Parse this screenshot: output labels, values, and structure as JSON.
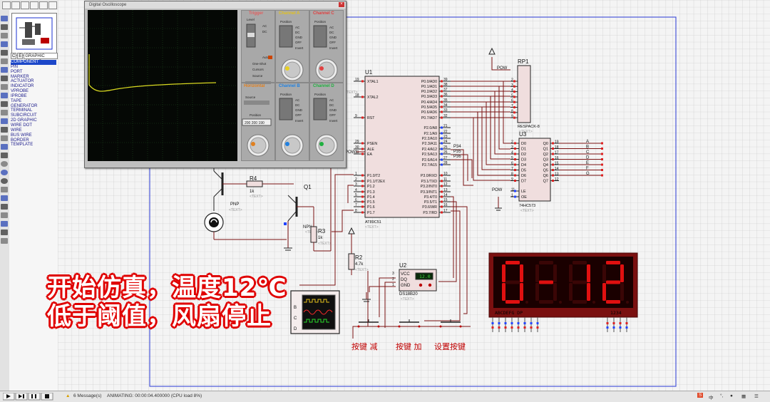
{
  "oscilloscope": {
    "title": "Digital Oscilloscope",
    "channel_a": "Channel A",
    "channel_b": "Channel B",
    "channel_c": "Channel C",
    "channel_d": "Channel D",
    "trigger": "Trigger",
    "horizontal": "Horizontal",
    "labels": {
      "level": "Level",
      "position": "Position",
      "auto": "Auto",
      "one_shot": "One-Shot",
      "cursors": "Cursors",
      "source": "Source",
      "ac": "AC",
      "dc": "DC",
      "gnd": "GND",
      "off": "OFF",
      "invert": "Invert"
    },
    "readout": "200 200 190",
    "trace_color": "#d8d820"
  },
  "mode_tabs": [
    "C",
    "E",
    "GRAPHIC STYLES"
  ],
  "mode_list": [
    "COMPONENT",
    "PIN",
    "PORT",
    "MARKER",
    "ACTUATOR",
    "INDICATOR",
    "VPROBE",
    "IPROBE",
    "TAPE",
    "GENERATOR",
    "TERMINAL",
    "SUBCIRCUIT",
    "2D GRAPHIC",
    "WIRE DOT",
    "WIRE",
    "BUS WIRE",
    "BORDER",
    "TEMPLATE"
  ],
  "mode_selected": "COMPONENT",
  "circuit": {
    "u1": {
      "ref": "U1",
      "part": "AT89C51",
      "text": "<TEXT>",
      "left_pins": [
        {
          "num": "19",
          "name": "XTAL1"
        },
        {
          "num": "18",
          "name": "XTAL2"
        },
        {
          "num": "9",
          "name": "RST"
        },
        {
          "num": "29",
          "name": "PSEN"
        },
        {
          "num": "30",
          "name": "ALE"
        },
        {
          "num": "31",
          "name": "EA"
        },
        {
          "num": "1",
          "name": "P1.0/T2"
        },
        {
          "num": "2",
          "name": "P1.1/T2EX"
        },
        {
          "num": "3",
          "name": "P1.2"
        },
        {
          "num": "4",
          "name": "P1.3"
        },
        {
          "num": "5",
          "name": "P1.4"
        },
        {
          "num": "6",
          "name": "P1.5"
        },
        {
          "num": "7",
          "name": "P1.6"
        },
        {
          "num": "8",
          "name": "P1.7"
        }
      ],
      "right_pins": [
        {
          "num": "39",
          "name": "P0.0/AD0"
        },
        {
          "num": "38",
          "name": "P0.1/AD1"
        },
        {
          "num": "37",
          "name": "P0.2/AD2"
        },
        {
          "num": "36",
          "name": "P0.3/AD3"
        },
        {
          "num": "35",
          "name": "P0.4/AD4"
        },
        {
          "num": "34",
          "name": "P0.5/AD5"
        },
        {
          "num": "33",
          "name": "P0.6/AD6"
        },
        {
          "num": "32",
          "name": "P0.7/AD7"
        },
        {
          "num": "21",
          "name": "P2.0/A8"
        },
        {
          "num": "22",
          "name": "P2.1/A9"
        },
        {
          "num": "23",
          "name": "P2.2/A10"
        },
        {
          "num": "24",
          "name": "P2.3/A11"
        },
        {
          "num": "25",
          "name": "P2.4/A12"
        },
        {
          "num": "26",
          "name": "P2.5/A13"
        },
        {
          "num": "27",
          "name": "P2.6/A14"
        },
        {
          "num": "28",
          "name": "P2.7/A15"
        },
        {
          "num": "10",
          "name": "P3.0/RXD"
        },
        {
          "num": "11",
          "name": "P3.1/TXD"
        },
        {
          "num": "12",
          "name": "P3.2/INT0"
        },
        {
          "num": "13",
          "name": "P3.3/INT1"
        },
        {
          "num": "14",
          "name": "P3.4/T0"
        },
        {
          "num": "15",
          "name": "P3.5/T1"
        },
        {
          "num": "16",
          "name": "P3.6/WR"
        },
        {
          "num": "17",
          "name": "P3.7/RD"
        }
      ]
    },
    "rp1": {
      "ref": "RP1",
      "part": "RESPACK-8",
      "text": "<TEXT>",
      "pow": "POW",
      "pins": [
        "2",
        "3",
        "4",
        "5",
        "6",
        "7",
        "8",
        "9"
      ]
    },
    "u3": {
      "ref": "U3",
      "part": "74HC573",
      "text": "<TEXT>",
      "d_pins": [
        {
          "num": "2",
          "name": "D0"
        },
        {
          "num": "3",
          "name": "D1"
        },
        {
          "num": "4",
          "name": "D2"
        },
        {
          "num": "5",
          "name": "D3"
        },
        {
          "num": "6",
          "name": "D4"
        },
        {
          "num": "7",
          "name": "D5"
        },
        {
          "num": "8",
          "name": "D6"
        },
        {
          "num": "9",
          "name": "D7"
        }
      ],
      "q_pins": [
        {
          "num": "19",
          "name": "Q0"
        },
        {
          "num": "18",
          "name": "Q1"
        },
        {
          "num": "17",
          "name": "Q2"
        },
        {
          "num": "16",
          "name": "Q3"
        },
        {
          "num": "15",
          "name": "Q4"
        },
        {
          "num": "14",
          "name": "Q5"
        },
        {
          "num": "13",
          "name": "Q6"
        },
        {
          "num": "12",
          "name": "Q7"
        }
      ],
      "le": {
        "num": "11",
        "name": "LE"
      },
      "oe": {
        "num": "1",
        "name": "OE"
      },
      "pow": "POW",
      "outputs": [
        "A",
        "B",
        "C",
        "D",
        "E",
        "F",
        "G"
      ]
    },
    "p2_labels": [
      "P34",
      "P35",
      "P36"
    ],
    "pow1": "POW1",
    "u2": {
      "ref": "U2",
      "part": "DS18B20",
      "text": "<TEXT>",
      "pins": [
        "VCC",
        "DQ",
        "GND"
      ],
      "pin_nums": [
        "3",
        "2",
        "1"
      ],
      "reading": "12.0"
    },
    "r2": {
      "ref": "R2",
      "value": "4.7k",
      "text": "<TEXT>"
    },
    "r3": {
      "ref": "R3",
      "value": "1k",
      "text": "<TEXT>"
    },
    "r4": {
      "ref": "R4",
      "value": "1k",
      "text": "<TEXT>"
    },
    "q1": {
      "ref": "Q1",
      "type": "NPN",
      "text": "<TEXT>"
    },
    "pnp": {
      "type": "PNP",
      "text": "<TEXT>"
    },
    "scope_inputs": [
      "B",
      "C",
      "D"
    ],
    "display": {
      "digits": "0-12",
      "label_left": "ABCDEFG DP",
      "label_right": "1234",
      "color": "#e01010"
    },
    "buttons": [
      "按键 减",
      "按键 加",
      "设置按键"
    ]
  },
  "overlay": {
    "line1": "开始仿真，温度12℃",
    "line2": "低于阈值，风扇停止"
  },
  "status": {
    "messages": "6 Message(s)",
    "animating": "ANIMATING: 00:00:04.400000 (CPU load 8%)"
  },
  "tray": {
    "ime": "中"
  }
}
